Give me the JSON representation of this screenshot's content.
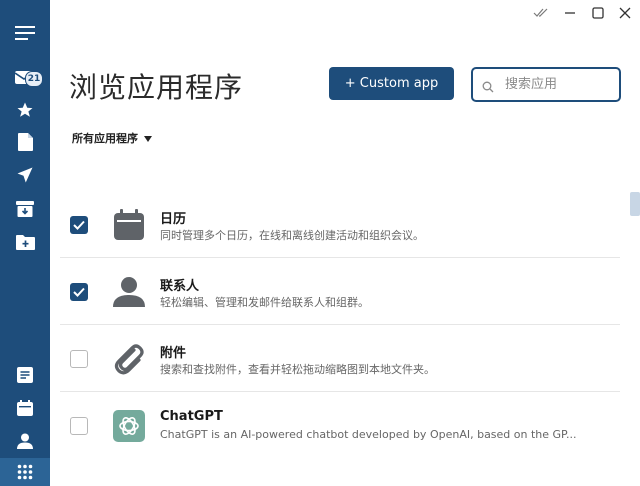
{
  "sidebar": {
    "mail_badge": "21"
  },
  "header": {
    "title": "浏览应用程序",
    "custom_app_button": "+ Custom app",
    "search_placeholder": "搜索应用"
  },
  "filter": {
    "label": "所有应用程序"
  },
  "apps": [
    {
      "name": "日历",
      "description": "同时管理多个日历，在线和离线创建活动和组织会议。",
      "enabled": true
    },
    {
      "name": "联系人",
      "description": "轻松编辑、管理和发邮件给联系人和组群。",
      "enabled": true
    },
    {
      "name": "附件",
      "description": "搜索和查找附件，查看并轻松拖动缩略图到本地文件夹。",
      "enabled": false
    },
    {
      "name": "ChatGPT",
      "description": "ChatGPT is an AI-powered chatbot developed by OpenAI, based on the GP...",
      "enabled": false
    }
  ],
  "colors": {
    "sidebar": "#1e4d7b",
    "accent": "#1e4d7b",
    "chatgpt_icon": "#74aa9c"
  }
}
